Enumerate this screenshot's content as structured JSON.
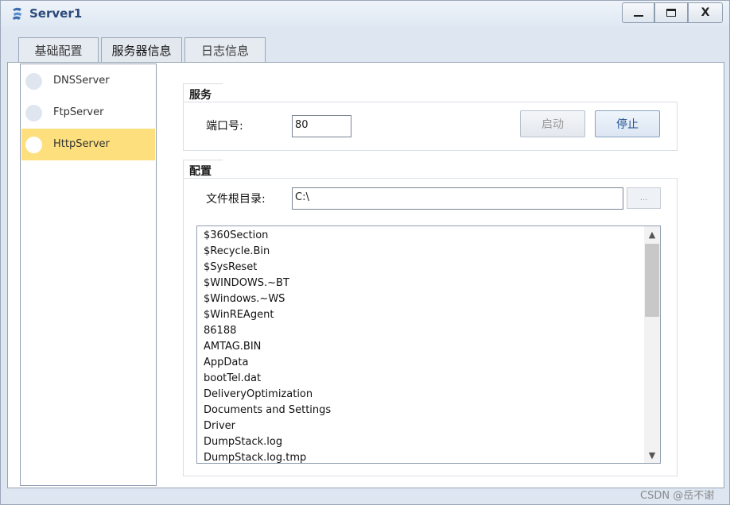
{
  "window": {
    "title": "Server1",
    "controls": {
      "minimize": "—",
      "maximize": "☐",
      "close": "X"
    },
    "accent": "#2c4a78"
  },
  "tabs": [
    {
      "label": "基础配置",
      "active": false
    },
    {
      "label": "服务器信息",
      "active": true
    },
    {
      "label": "日志信息",
      "active": false
    }
  ],
  "servers": [
    {
      "label": "DNSServer",
      "selected": false
    },
    {
      "label": "FtpServer",
      "selected": false
    },
    {
      "label": "HttpServer",
      "selected": true
    }
  ],
  "service_group": {
    "title": "服务",
    "port_label": "端口号:",
    "port_value": "80",
    "start_label": "启动",
    "stop_label": "停止"
  },
  "config_group": {
    "title": "配置",
    "root_label": "文件根目录:",
    "root_value": "C:\\",
    "browse_label": "..."
  },
  "files": [
    "$360Section",
    "$Recycle.Bin",
    "$SysReset",
    "$WINDOWS.~BT",
    "$Windows.~WS",
    "$WinREAgent",
    "86188",
    "AMTAG.BIN",
    "AppData",
    "bootTel.dat",
    "DeliveryOptimization",
    "Documents and Settings",
    "Driver",
    "DumpStack.log",
    "DumpStack.log.tmp"
  ],
  "selection_color": "#fde07d",
  "watermark": "CSDN @岳不谢"
}
